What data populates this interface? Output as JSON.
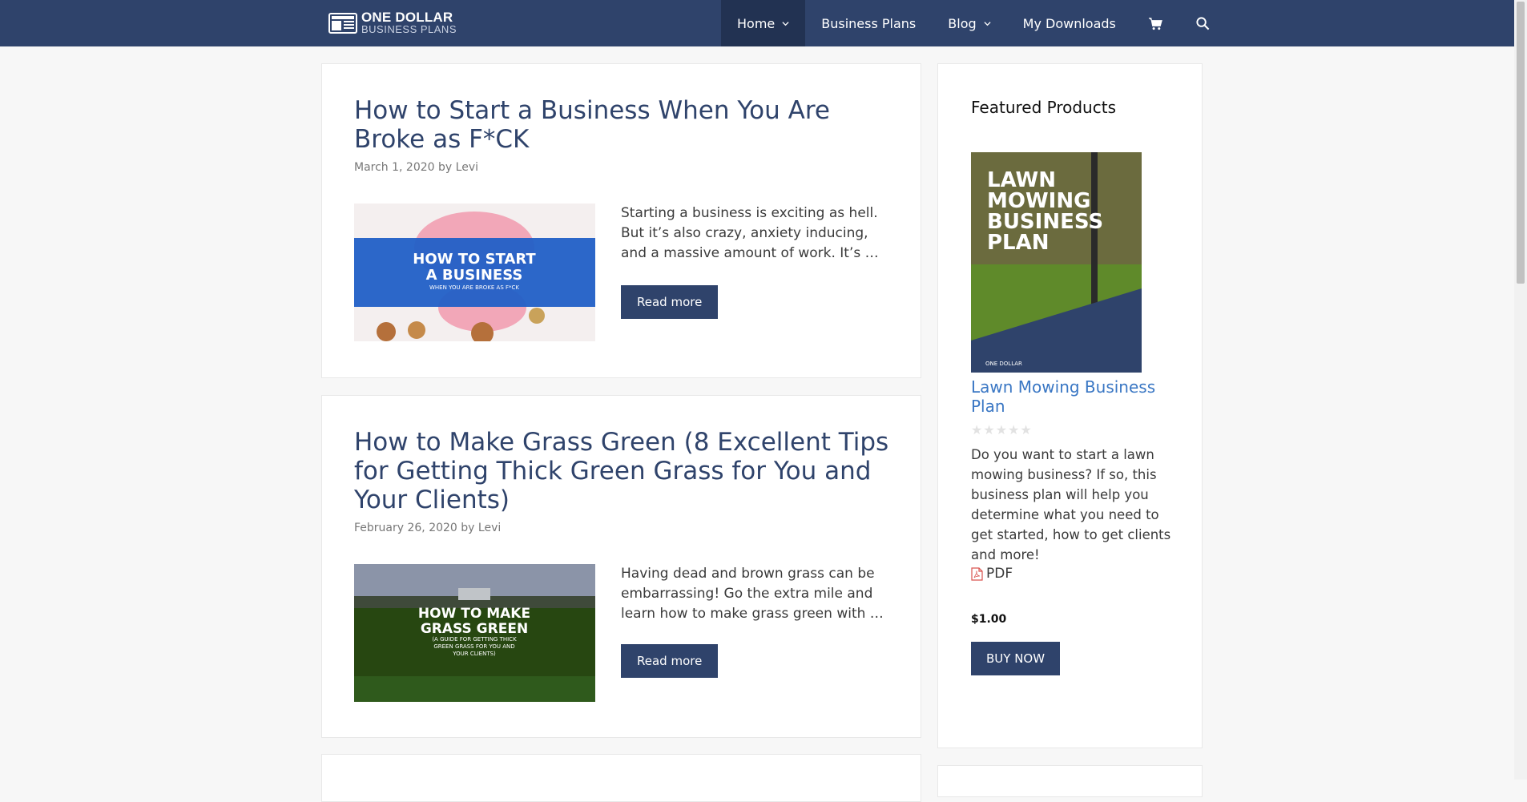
{
  "brand": {
    "line1": "ONE DOLLAR",
    "line2": "BUSINESS PLANS"
  },
  "nav": {
    "home": "Home",
    "business_plans": "Business Plans",
    "blog": "Blog",
    "my_downloads": "My Downloads",
    "cart_icon": "cart-icon",
    "search_icon": "search-icon"
  },
  "articles": [
    {
      "title": "How to Start a Business When You Are Broke as F*CK",
      "date": "March 1, 2020",
      "by": "by",
      "author": "Levi",
      "excerpt": "Starting a business is exciting as hell. But it’s also crazy, anxiety inducing, and a massive amount of work. It’s …",
      "read_more": "Read more",
      "thumb_line1": "HOW TO START",
      "thumb_line2": "A BUSINESS",
      "thumb_line3": "WHEN YOU ARE BROKE AS F*CK"
    },
    {
      "title": "How to Make Grass Green (8 Excellent Tips for Getting Thick Green Grass for You and Your Clients)",
      "date": "February 26, 2020",
      "by": "by",
      "author": "Levi",
      "excerpt": "Having dead and brown grass can be embarrassing! Go the extra mile and learn how to make grass green with …",
      "read_more": "Read more",
      "thumb_line1": "HOW TO MAKE",
      "thumb_line2": "GRASS GREEN",
      "thumb_line3": "(A GUIDE FOR GETTING THICK",
      "thumb_line4": "GREEN GRASS FOR YOU AND",
      "thumb_line5": "YOUR CLIENTS)"
    }
  ],
  "sidebar": {
    "title": "Featured Products",
    "product": {
      "cover_line1": "LAWN",
      "cover_line2": "MOWING",
      "cover_line3": "BUSINESS",
      "cover_line4": "PLAN",
      "cover_brand": "ONE DOLLAR",
      "name": "Lawn Mowing Business Plan",
      "rating": 0,
      "stars": "★★★★★",
      "description": "Do you want to start a lawn mowing business? If so, this business plan will help you determine what you need to get started, how to get clients and more!",
      "format": "PDF",
      "price": "$1.00",
      "buy": "BUY NOW"
    }
  },
  "colors": {
    "header": "#2f436b",
    "link": "#3a77c4",
    "button": "#2f436b"
  }
}
